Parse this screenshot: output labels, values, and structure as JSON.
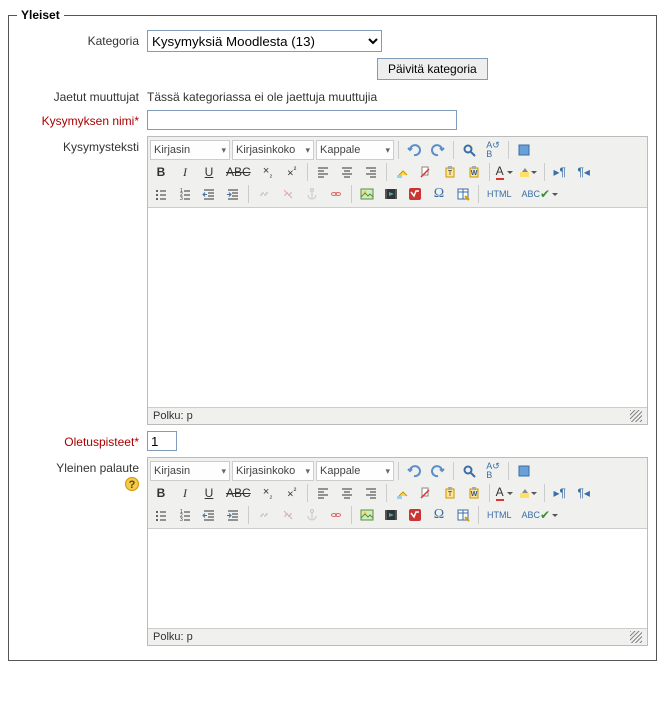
{
  "legend": "Yleiset",
  "labels": {
    "category": "Kategoria",
    "shared_vars": "Jaetut muuttujat",
    "question_name": "Kysymyksen nimi",
    "question_text": "Kysymysteksti",
    "default_mark": "Oletuspisteet",
    "general_feedback": "Yleinen palaute"
  },
  "category": {
    "selected": "Kysymyksiä Moodlesta (13)"
  },
  "buttons": {
    "update_category": "Päivitä kategoria"
  },
  "shared_vars_text": "Tässä kategoriassa ei ole jaettuja muuttujia",
  "fields": {
    "question_name": "",
    "default_mark": "1"
  },
  "editor": {
    "font_family": "Kirjasin",
    "font_size": "Kirjasinkoko",
    "format": "Kappale",
    "path_label": "Polku: p",
    "abc_label": "ABC",
    "html_label": "HTML",
    "spellcheck_label": "ABC"
  },
  "heights": {
    "question_text_body": 200,
    "general_feedback_body": 100
  }
}
